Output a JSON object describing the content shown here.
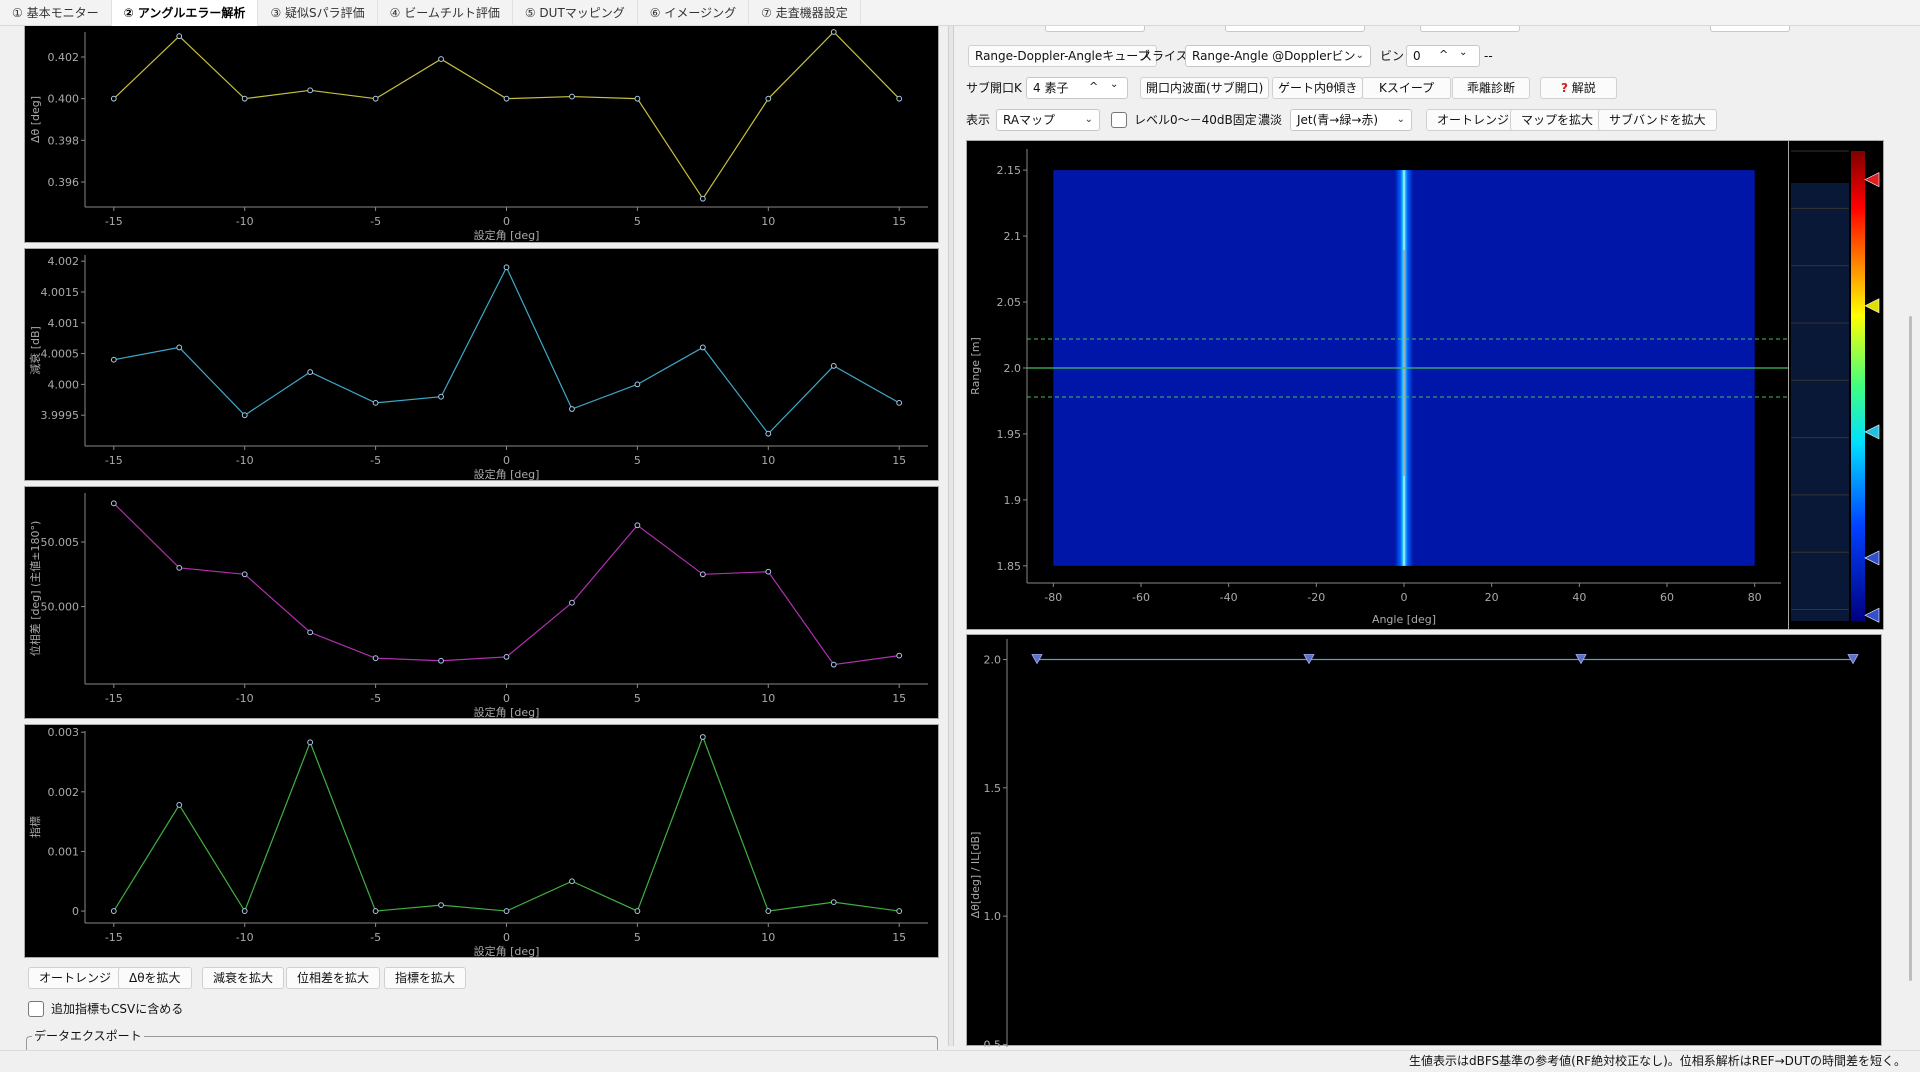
{
  "tabs": [
    {
      "label": "① 基本モニター",
      "active": false
    },
    {
      "label": "② アングルエラー解析",
      "active": true
    },
    {
      "label": "③ 疑似Sパラ評価",
      "active": false
    },
    {
      "label": "④ ビームチルト評価",
      "active": false
    },
    {
      "label": "⑤ DUTマッピング",
      "active": false
    },
    {
      "label": "⑥ イメージング",
      "active": false
    },
    {
      "label": "⑦ 走査機器設定",
      "active": false
    }
  ],
  "left": {
    "charts": [
      {
        "key": "delta_theta",
        "color": "#c8c040",
        "ylabel": "Δθ [deg]",
        "xlabel": "設定角 [deg]",
        "ylim": [
          0.3948,
          0.4032
        ],
        "yticks": [
          0.396,
          0.398,
          0.4,
          0.402
        ],
        "ytick_labels": [
          "0.396",
          "0.398",
          "0.400",
          "0.402"
        ],
        "x": [
          -15,
          -12.5,
          -10,
          -7.5,
          -5,
          -2.5,
          0,
          2.5,
          5,
          7.5,
          10,
          12.5,
          15
        ],
        "y": [
          0.4,
          0.403,
          0.4,
          0.4004,
          0.4,
          0.4019,
          0.4,
          0.4001,
          0.4,
          0.3952,
          0.4,
          0.4032,
          0.4
        ]
      },
      {
        "key": "attenuation",
        "color": "#40a8c8",
        "ylabel": "減衰 [dB]",
        "xlabel": "設定角 [deg]",
        "ylim": [
          3.999,
          4.0021
        ],
        "yticks": [
          3.9995,
          4.0,
          4.0005,
          4.001,
          4.0015,
          4.002
        ],
        "ytick_labels": [
          "3.9995",
          "4.000",
          "4.0005",
          "4.001",
          "4.0015",
          "4.002"
        ],
        "x": [
          -15,
          -12.5,
          -10,
          -7.5,
          -5,
          -2.5,
          0,
          2.5,
          5,
          7.5,
          10,
          12.5,
          15
        ],
        "y": [
          4.0004,
          4.0006,
          3.9995,
          4.0002,
          3.9997,
          3.9998,
          4.0019,
          3.9996,
          4.0,
          4.0006,
          3.9992,
          4.0003,
          3.9997
        ]
      },
      {
        "key": "phase_diff",
        "color": "#b030b0",
        "ylabel": "位相差 [deg] (主値±180°)",
        "xlabel": "設定角 [deg]",
        "ylim": [
          49.994,
          50.0088
        ],
        "yticks": [
          50.0,
          50.005
        ],
        "ytick_labels": [
          "50.000",
          "50.005"
        ],
        "x": [
          -15,
          -12.5,
          -10,
          -7.5,
          -5,
          -2.5,
          0,
          2.5,
          5,
          7.5,
          10,
          12.5,
          15
        ],
        "y": [
          50.008,
          50.003,
          50.0025,
          49.998,
          49.996,
          49.9958,
          49.9961,
          50.0003,
          50.0063,
          50.0025,
          50.0027,
          49.9955,
          49.9962
        ]
      },
      {
        "key": "indicator",
        "color": "#40b040",
        "ylabel": "指標",
        "xlabel": "設定角 [deg]",
        "ylim": [
          -0.0002,
          0.00302
        ],
        "yticks": [
          0,
          0.001,
          0.002,
          0.003
        ],
        "ytick_labels": [
          "0",
          "0.001",
          "0.002",
          "0.003"
        ],
        "x": [
          -15,
          -12.5,
          -10,
          -7.5,
          -5,
          -2.5,
          0,
          2.5,
          5,
          7.5,
          10,
          12.5,
          15
        ],
        "y": [
          0,
          0.00178,
          0,
          0.00283,
          0,
          0.0001,
          0,
          0.0005,
          0,
          0.00292,
          0,
          0.00015,
          0
        ]
      }
    ],
    "xticks": [
      -15,
      -10,
      -5,
      0,
      5,
      10,
      15
    ],
    "buttons": {
      "autorange": "オートレンジ",
      "zoom_dtheta": "Δθを拡大",
      "zoom_atten": "減衰を拡大",
      "zoom_phase": "位相差を拡大",
      "zoom_index": "指標を拡大"
    },
    "csv_checkbox": "追加指標もCSVに含める",
    "export_group": "データエクスポート"
  },
  "right": {
    "cube_button": "Range-Doppler-Angleキューブ",
    "slice_label": "スライス",
    "slice_value": "Range-Angle @Dopplerビン",
    "bin_label": "ビン",
    "bin_value": "0",
    "bin_extra": "--",
    "subaperture_label": "サブ開口K",
    "subaperture_value": "4 素子",
    "btn_aperture_wave": "開口内波面(サブ開口)",
    "btn_gate_tilt": "ゲート内θ傾き",
    "btn_ksweep": "Kスイープ",
    "btn_divergence": "乖離診断",
    "btn_help": "解説",
    "display_label": "表示",
    "display_value": "RAマップ",
    "level_checkbox": "レベル0〜－40dB固定",
    "shade_label": "濃淡",
    "shade_value": "Jet(青→緑→赤)",
    "btn_autorange": "オートレンジ",
    "btn_zoom_map": "マップを拡大",
    "btn_zoom_subband": "サブバンドを拡大",
    "ra_map": {
      "xlabel": "Angle [deg]",
      "ylabel": "Range [m]",
      "xticks": [
        -80,
        -60,
        -40,
        -20,
        0,
        20,
        40,
        60,
        80
      ],
      "yticks": [
        1.85,
        1.9,
        1.95,
        2.0,
        2.05,
        2.1,
        2.15
      ],
      "ytick_labels": [
        "1.85",
        "1.9",
        "1.95",
        "2.0",
        "2.05",
        "2.1",
        "2.15"
      ],
      "xlim": [
        -86,
        86
      ],
      "ylim": [
        1.837,
        2.166
      ],
      "map_extent_x": [
        -80,
        80
      ],
      "map_extent_y": [
        1.85,
        2.15
      ],
      "beam_angle": 0,
      "range_marker": 2.0,
      "gate_lines": [
        1.978,
        2.022
      ]
    },
    "colorbar": {
      "ticks": [
        0,
        -10,
        -20,
        -30,
        -40,
        -50,
        -60,
        -70,
        -80
      ],
      "range": [
        0,
        -82
      ],
      "markers": [
        {
          "value": 3,
          "color": "#e02020"
        },
        {
          "value": -5,
          "color": "#e02020"
        },
        {
          "value": -27,
          "color": "#e0e000"
        },
        {
          "value": -49,
          "color": "#20c0e0"
        },
        {
          "value": -71,
          "color": "#3050d0"
        },
        {
          "value": -81,
          "color": "#3050d0"
        }
      ]
    },
    "subband_chart": {
      "ylabel": "Δθ[deg] / IL[dB]",
      "yticks": [
        0.5,
        1.0,
        1.5,
        2.0
      ],
      "ytick_labels": [
        "0.5",
        "1.0",
        "1.5",
        "2.0"
      ],
      "ylim": [
        0.49,
        2.08
      ],
      "points_x": [
        0,
        1,
        2,
        3
      ],
      "points_y": [
        2.0,
        2.0,
        2.0,
        2.0
      ]
    }
  },
  "status": "生値表示はdBFS基準の参考値(RF絶対校正なし)。位相系解析はREF→DUTの時間差を短く。"
}
